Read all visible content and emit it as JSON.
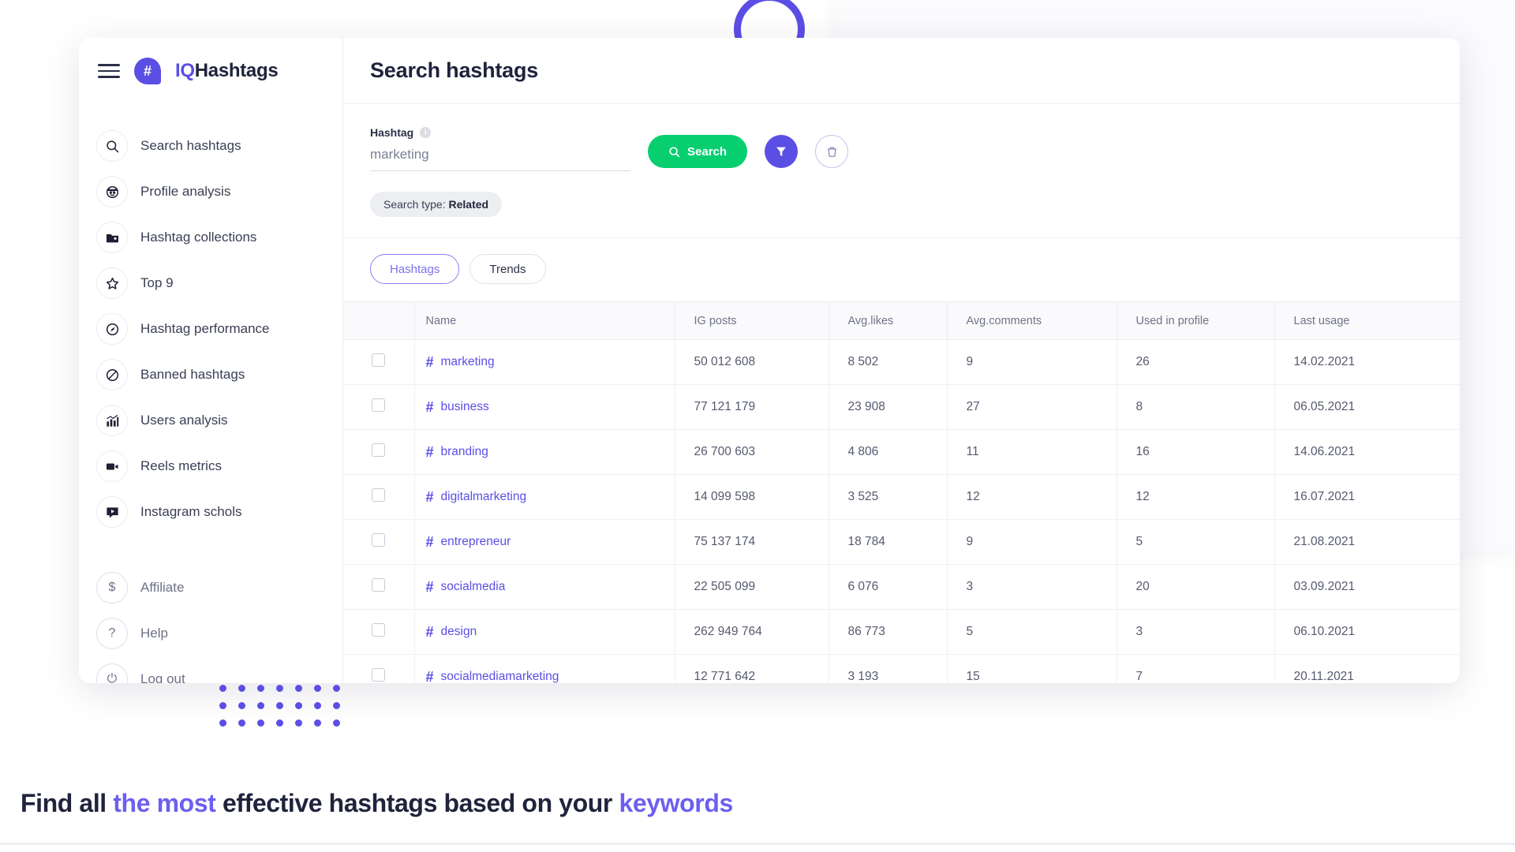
{
  "brand": {
    "iq": "IQ",
    "name": "Hashtags",
    "hash_glyph": "#",
    "menu_icon": "hamburger-menu-icon"
  },
  "sidebar": {
    "items": [
      {
        "label": "Search hashtags",
        "icon": "search-icon"
      },
      {
        "label": "Profile analysis",
        "icon": "face-icon"
      },
      {
        "label": "Hashtag collections",
        "icon": "folder-icon"
      },
      {
        "label": "Top 9",
        "icon": "star-icon"
      },
      {
        "label": "Hashtag performance",
        "icon": "speedometer-icon"
      },
      {
        "label": "Banned hashtags",
        "icon": "ban-icon"
      },
      {
        "label": "Users analysis",
        "icon": "bar-chart-icon"
      },
      {
        "label": "Reels metrics",
        "icon": "video-camera-icon"
      },
      {
        "label": "Instagram schols",
        "icon": "play-box-icon"
      }
    ],
    "bottom_items": [
      {
        "label": "Affiliate",
        "icon": "dollar-icon",
        "glyph": "$"
      },
      {
        "label": "Help",
        "icon": "question-icon",
        "glyph": "?"
      },
      {
        "label": "Log out",
        "icon": "power-icon",
        "glyph": "⏻"
      }
    ]
  },
  "header": {
    "title": "Search hashtags"
  },
  "search": {
    "field_label": "Hashtag",
    "info_glyph": "i",
    "value": "marketing",
    "placeholder": "marketing",
    "search_button": "Search",
    "search_icon": "magnifier-icon",
    "filter_icon": "funnel-icon",
    "trash_icon": "trash-icon",
    "chip_prefix": "Search type: ",
    "chip_value": "Related"
  },
  "tabs": [
    {
      "label": "Hashtags",
      "active": true
    },
    {
      "label": "Trends",
      "active": false
    }
  ],
  "table": {
    "columns": [
      "",
      "Name",
      "IG posts",
      "Avg.likes",
      "Avg.comments",
      "Used in profile",
      "Last usage"
    ],
    "rows": [
      {
        "name": "marketing",
        "ig_posts": "50 012 608",
        "avg_likes": "8 502",
        "avg_comments": "9",
        "used_in_profile": "26",
        "last_usage": "14.02.2021",
        "checked": false
      },
      {
        "name": "business",
        "ig_posts": "77 121 179",
        "avg_likes": "23 908",
        "avg_comments": "27",
        "used_in_profile": "8",
        "last_usage": "06.05.2021",
        "checked": false
      },
      {
        "name": "branding",
        "ig_posts": "26 700 603",
        "avg_likes": "4 806",
        "avg_comments": "11",
        "used_in_profile": "16",
        "last_usage": "14.06.2021",
        "checked": false
      },
      {
        "name": "digitalmarketing",
        "ig_posts": "14 099 598",
        "avg_likes": "3 525",
        "avg_comments": "12",
        "used_in_profile": "12",
        "last_usage": "16.07.2021",
        "checked": false
      },
      {
        "name": "entrepreneur",
        "ig_posts": "75 137 174",
        "avg_likes": "18 784",
        "avg_comments": "9",
        "used_in_profile": "5",
        "last_usage": "21.08.2021",
        "checked": false
      },
      {
        "name": "socialmedia",
        "ig_posts": "22 505 099",
        "avg_likes": "6 076",
        "avg_comments": "3",
        "used_in_profile": "20",
        "last_usage": "03.09.2021",
        "checked": false
      },
      {
        "name": "design",
        "ig_posts": "262 949 764",
        "avg_likes": "86 773",
        "avg_comments": "5",
        "used_in_profile": "3",
        "last_usage": "06.10.2021",
        "checked": false
      },
      {
        "name": "socialmediamarketing",
        "ig_posts": "12 771 642",
        "avg_likes": "3 193",
        "avg_comments": "15",
        "used_in_profile": "7",
        "last_usage": "20.11.2021",
        "checked": false
      }
    ],
    "hash_glyph": "#"
  },
  "caption": {
    "part1": "Find all ",
    "highlight1": "the most",
    "part2": " effective hashtags based on your ",
    "highlight2": "keywords"
  },
  "colors": {
    "accent_purple": "#5b4ee5",
    "accent_green": "#07cf70",
    "accent_yellow": "#f5c83b",
    "text_dark": "#20233c",
    "text_muted": "#6f7387"
  }
}
